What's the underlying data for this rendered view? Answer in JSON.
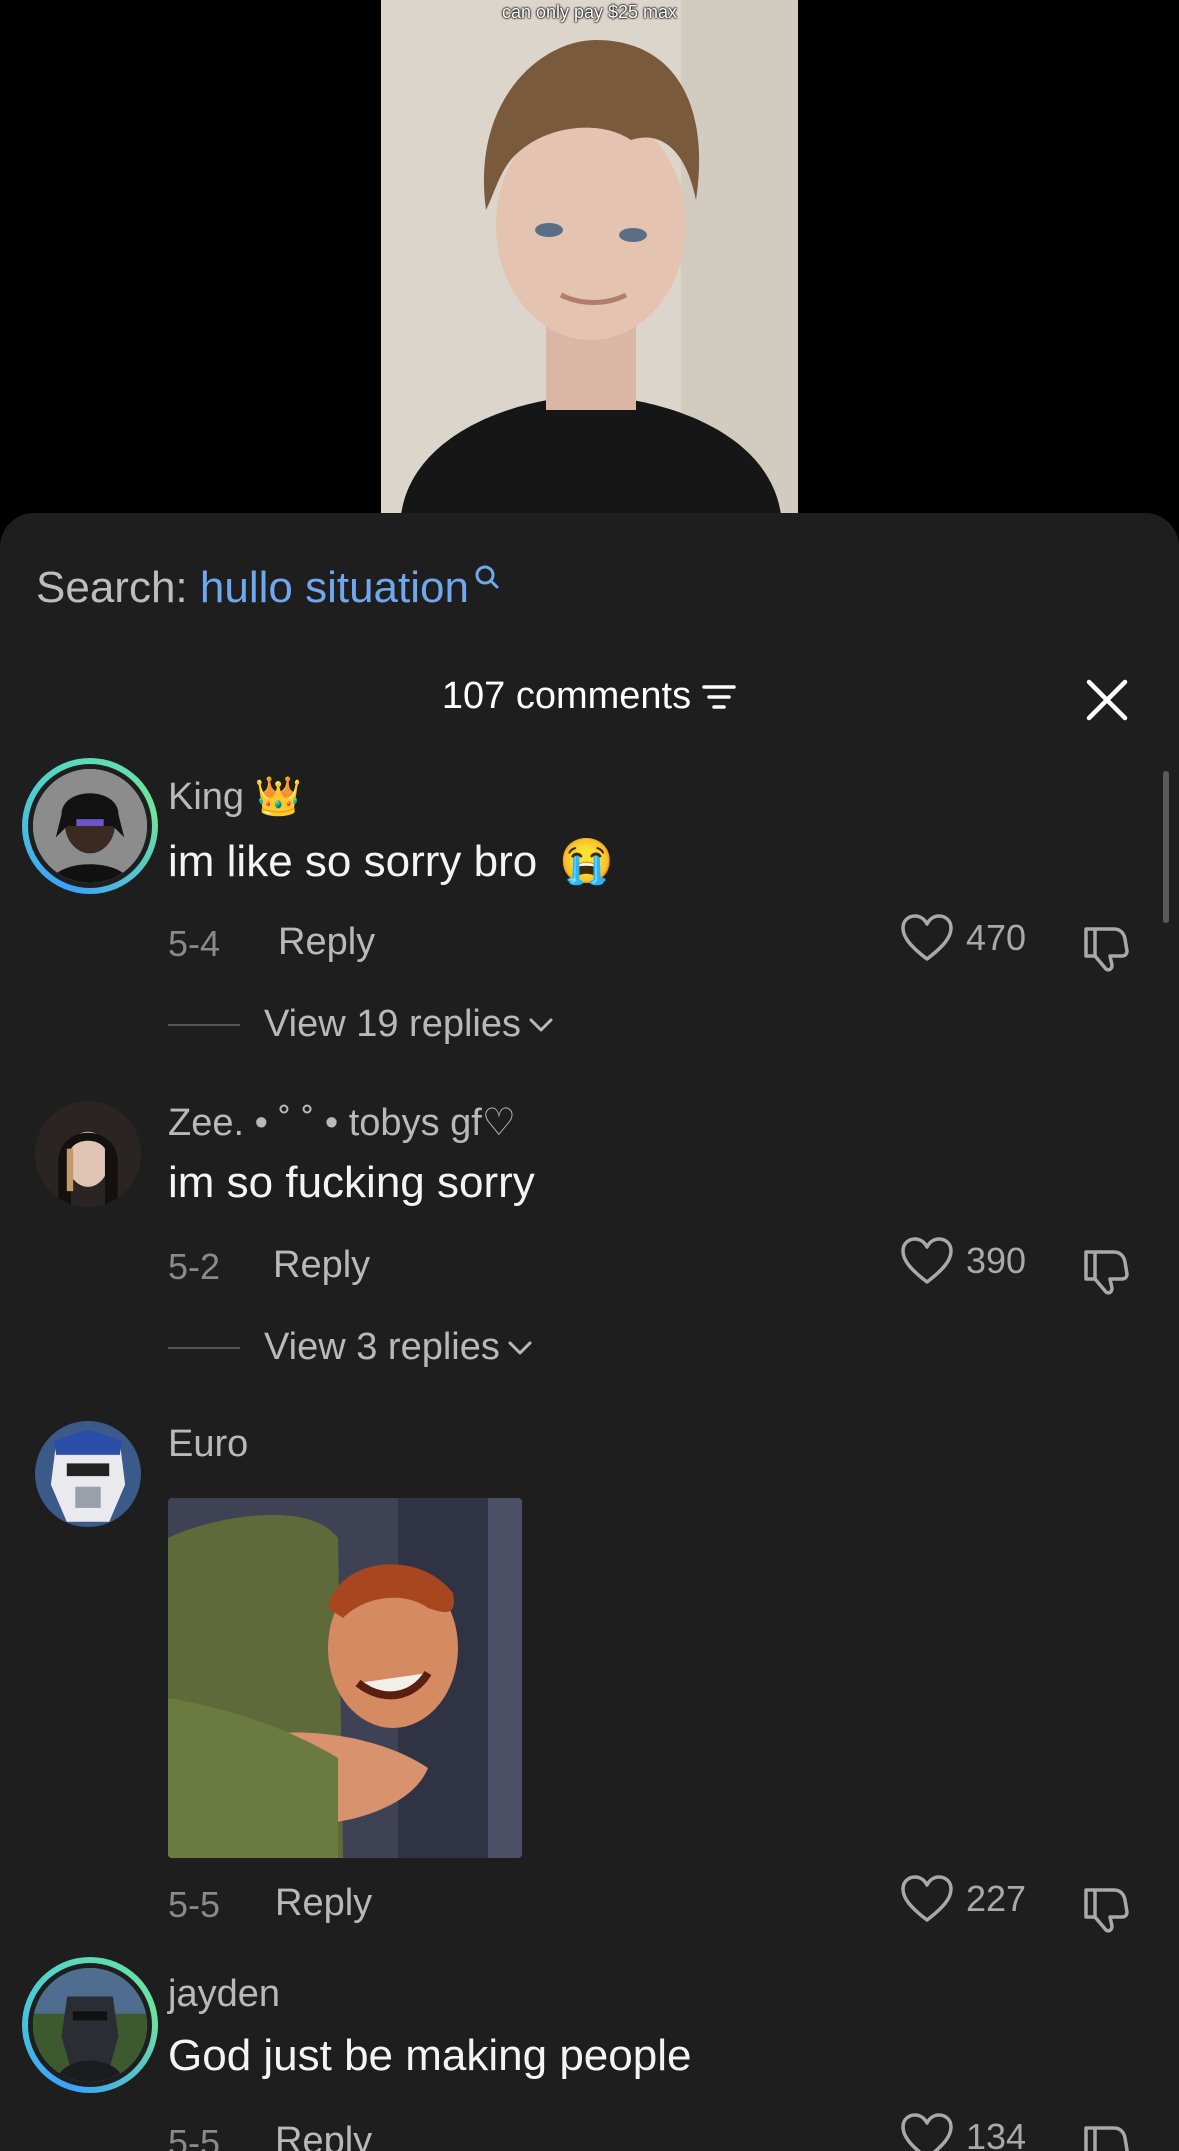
{
  "video": {
    "caption": "can only pay $25 max"
  },
  "search": {
    "label": "Search: ",
    "query": "hullo situation"
  },
  "header": {
    "comments_count": "107 comments"
  },
  "comments": [
    {
      "username": "King",
      "text": "im like so sorry bro",
      "date": "5-4",
      "reply_label": "Reply",
      "likes": "470",
      "view_replies": "View 19 replies"
    },
    {
      "username": "Zee. • ˚ ˚  • tobys gf♡",
      "text": "im so fucking sorry",
      "date": "5-2",
      "reply_label": "Reply",
      "likes": "390",
      "view_replies": "View 3 replies"
    },
    {
      "username": "Euro",
      "text": "",
      "date": "5-5",
      "reply_label": "Reply",
      "likes": "227"
    },
    {
      "username": "jayden",
      "text": "God just be making people",
      "date": "5-5",
      "reply_label": "Reply",
      "likes": "134"
    }
  ],
  "colors": {
    "sheet_bg": "#1e1e1e",
    "accent_blue": "#6fa8ee",
    "ring_start": "#3aa0ff",
    "ring_end": "#6fe39d"
  }
}
